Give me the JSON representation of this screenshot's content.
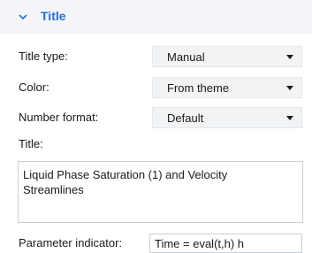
{
  "section": {
    "title": "Title",
    "icon": "chevron-down-icon",
    "accent_color": "#2a6bd6"
  },
  "fields": {
    "title_type": {
      "label": "Title type:",
      "value": "Manual"
    },
    "color": {
      "label": "Color:",
      "value": "From theme"
    },
    "number_format": {
      "label": "Number format:",
      "value": "Default"
    },
    "title": {
      "label": "Title:",
      "value": "Liquid Phase Saturation (1) and Velocity\nStreamlines"
    },
    "parameter_indicator": {
      "label": "Parameter indicator:",
      "value": "Time = eval(t,h) h"
    }
  }
}
